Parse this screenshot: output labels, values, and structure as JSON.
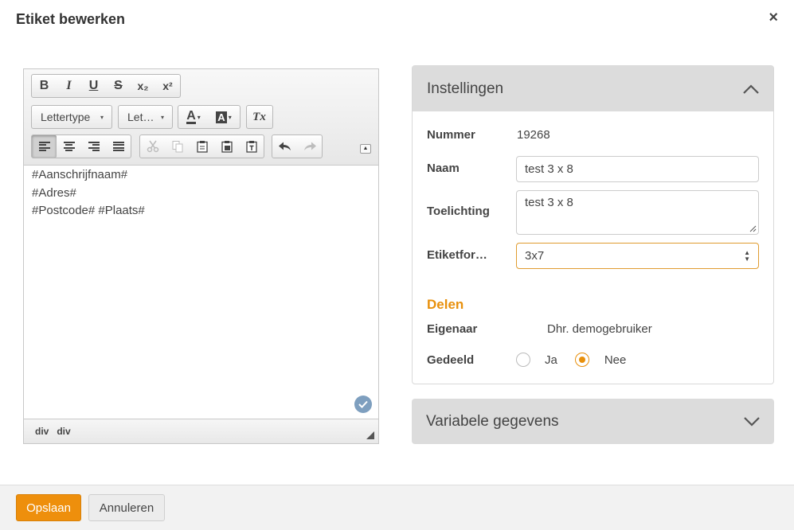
{
  "dialog": {
    "title": "Etiket bewerken",
    "close_icon": "×"
  },
  "editor": {
    "toolbar": {
      "bold": "B",
      "italic": "I",
      "underline": "U",
      "strike": "S",
      "subscript": "x₂",
      "superscript": "x²",
      "font_family": "Lettertype",
      "font_size": "Let…",
      "text_color_icon": "A",
      "bg_color_icon": "A",
      "remove_format_icon": "Tx",
      "dropdown_arrow": "▾",
      "collapse_icon": "▲"
    },
    "content": [
      "#Aanschrijfnaam#",
      "#Adres#",
      "#Postcode# #Plaats#"
    ],
    "status_path": [
      "div",
      "div"
    ]
  },
  "settings": {
    "header": "Instellingen",
    "nummer_label": "Nummer",
    "nummer_value": "19268",
    "naam_label": "Naam",
    "naam_value": "test 3 x 8",
    "toelichting_label": "Toelichting",
    "toelichting_value": "test 3 x 8",
    "etiketformaat_label": "Etiketfor…",
    "etiketformaat_value": "3x7",
    "select_arrows": "▲▼"
  },
  "delen": {
    "title": "Delen",
    "eigenaar_label": "Eigenaar",
    "eigenaar_value": "Dhr. demogebruiker",
    "gedeeld_label": "Gedeeld",
    "options": [
      {
        "label": "Ja",
        "checked": false
      },
      {
        "label": "Nee",
        "checked": true
      }
    ]
  },
  "variabele": {
    "header": "Variabele gegevens"
  },
  "footer": {
    "save_label": "Opslaan",
    "cancel_label": "Annuleren"
  },
  "colors": {
    "accent": "#ee8f0c",
    "panel_header_bg": "#dcdcdc",
    "badge": "#7e9fbf"
  }
}
